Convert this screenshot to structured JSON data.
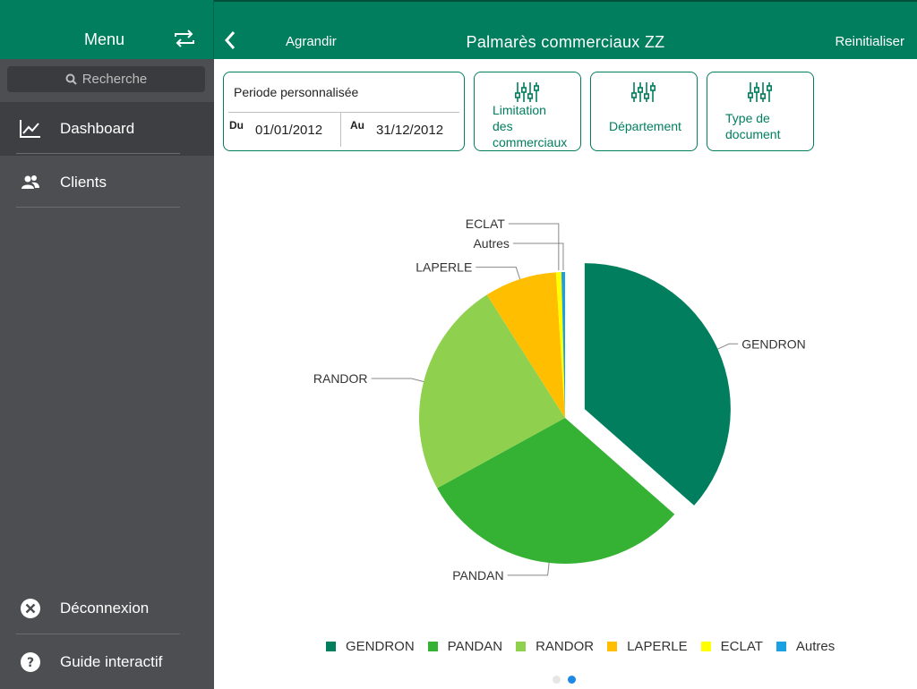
{
  "sidebar": {
    "title": "Menu",
    "search_placeholder": "Recherche",
    "items": [
      {
        "label": "Dashboard",
        "active": true
      },
      {
        "label": "Clients",
        "active": false
      }
    ],
    "bottom_items": [
      {
        "label": "Déconnexion"
      },
      {
        "label": "Guide interactif"
      }
    ]
  },
  "header": {
    "back_label": "Agrandir",
    "title": "Palmarès commerciaux ZZ",
    "reset_label": "Reinitialiser"
  },
  "filters": {
    "period": {
      "title": "Periode personnalisée",
      "from_label": "Du",
      "from_value": "01/01/2012",
      "to_label": "Au",
      "to_value": "31/12/2012"
    },
    "buttons": [
      {
        "line1": "Limitation",
        "line2": "des",
        "line3": "commerciaux"
      },
      {
        "line1": "Département"
      },
      {
        "line1": "Type de",
        "line2": "document"
      }
    ]
  },
  "colors": {
    "brand": "#007e5e",
    "sidebar": "#4d4e52"
  },
  "chart_data": {
    "type": "pie",
    "slices": [
      {
        "label": "GENDRON",
        "value": 36.5,
        "color": "#007e5e",
        "exploded": true
      },
      {
        "label": "PANDAN",
        "value": 30.5,
        "color": "#35b234"
      },
      {
        "label": "RANDOR",
        "value": 24.0,
        "color": "#8fd14f"
      },
      {
        "label": "LAPERLE",
        "value": 8.0,
        "color": "#ffbf00"
      },
      {
        "label": "ECLAT",
        "value": 0.6,
        "color": "#ffff00"
      },
      {
        "label": "Autres",
        "value": 0.4,
        "color": "#1ba1e2"
      }
    ],
    "legend_position": "bottom"
  },
  "pager": {
    "pages": 2,
    "current": 2
  }
}
